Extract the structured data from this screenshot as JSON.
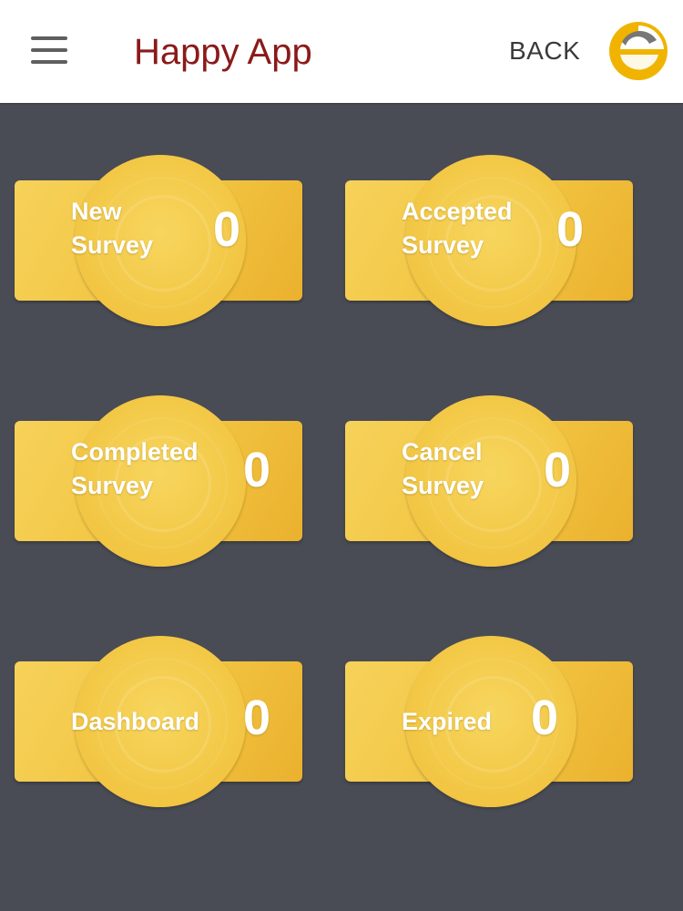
{
  "appbar": {
    "title": "Happy App",
    "back_label": "BACK"
  },
  "icons": {
    "menu": "hamburger-menu-icon",
    "logo": "brand-logo-icon"
  },
  "colors": {
    "title": "#8b1a1a",
    "tile": "#f2c441",
    "background": "#4a4c55"
  },
  "tiles": [
    {
      "line1": "New",
      "line2": "Survey",
      "count": "0"
    },
    {
      "line1": "Accepted",
      "line2": "Survey",
      "count": "0"
    },
    {
      "line1": "Completed",
      "line2": "Survey",
      "count": "0"
    },
    {
      "line1": "Cancel",
      "line2": "Survey",
      "count": "0"
    },
    {
      "line1": "Dashboard",
      "count": "0"
    },
    {
      "line1": "Expired",
      "count": "0"
    }
  ]
}
